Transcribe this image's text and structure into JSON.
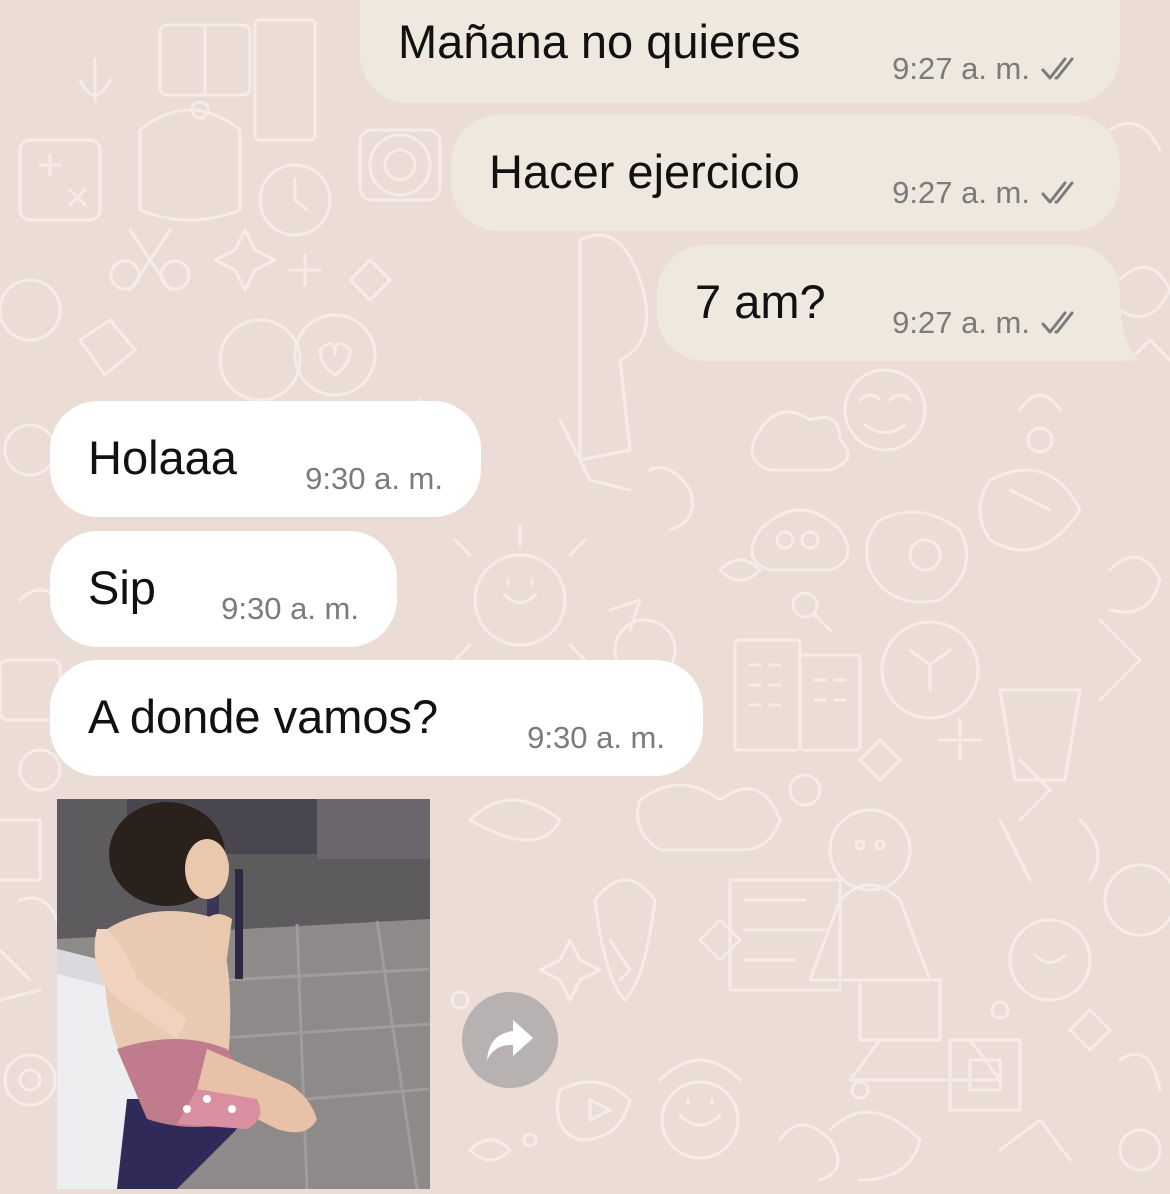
{
  "chat": {
    "outgoing": [
      {
        "text": "Mañana no quieres",
        "time": "9:27 a. m.",
        "status": "read-ticks"
      },
      {
        "text": "Hacer ejercicio",
        "time": "9:27 a. m.",
        "status": "read-ticks"
      },
      {
        "text": "7 am?",
        "time": "9:27 a. m.",
        "status": "read-ticks"
      }
    ],
    "incoming": [
      {
        "text": "Holaaa",
        "time": "9:30 a. m."
      },
      {
        "text": "Sip",
        "time": "9:30 a. m."
      },
      {
        "text": "A donde vamos?",
        "time": "9:30 a. m."
      }
    ],
    "media": {
      "kind": "gif",
      "icon": "forward-icon"
    }
  },
  "colors": {
    "wallpaper": "#ecdcd6",
    "outgoing_bubble": "#efe8df",
    "incoming_bubble": "#ffffff",
    "timestamp": "#7b7b7b",
    "forward_button": "#b7b2b1"
  }
}
